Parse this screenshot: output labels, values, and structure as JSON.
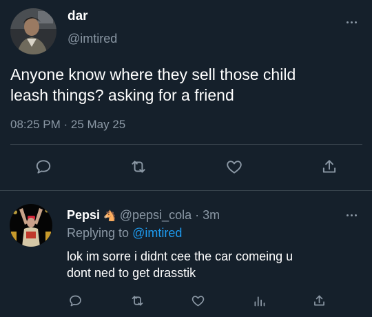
{
  "main_tweet": {
    "display_name": "dar",
    "handle": "@imtired",
    "text_line1": "Anyone know where they sell those child",
    "text_line2": "leash things? asking for a friend",
    "timestamp": "08:25 PM · 25 May 25"
  },
  "reply": {
    "display_name": "Pepsi",
    "emoji_badge": "🐴",
    "handle": "@pepsi_cola",
    "time_sep": " · ",
    "time": "3m",
    "replying_to_label": "Replying to ",
    "replying_to_handle": "@imtired",
    "text_line1": "lok im sorre i didnt cee the car comeing u",
    "text_line2": "dont ned to get drasstik"
  },
  "icons": {
    "reply": "speech-bubble-icon",
    "retweet": "retweet-arrows-icon",
    "like": "heart-icon",
    "share": "share-upload-icon",
    "analytics": "bar-chart-icon",
    "more": "more-dots-icon"
  },
  "colors": {
    "background": "#15202b",
    "text": "#ffffff",
    "muted": "#8b98a5",
    "accent": "#1d9bf0",
    "divider": "#38444d"
  }
}
